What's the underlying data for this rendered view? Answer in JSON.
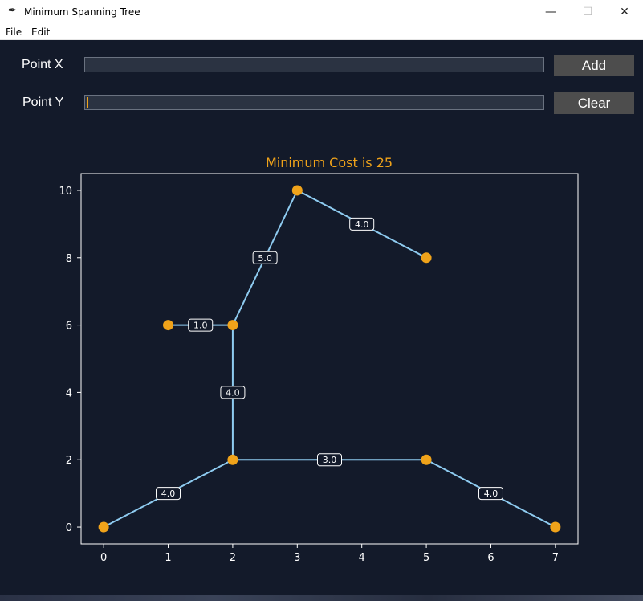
{
  "window": {
    "title": "Minimum Spanning Tree",
    "icon": "feather-icon"
  },
  "menu": {
    "file": "File",
    "edit": "Edit"
  },
  "form": {
    "point_x_label": "Point X",
    "point_x_value": "",
    "point_y_label": "Point Y",
    "point_y_value": "",
    "add_label": "Add",
    "clear_label": "Clear"
  },
  "colors": {
    "background": "#131a2a",
    "title": "#f0a31a",
    "node": "#f0a31a",
    "edge": "#8ecbf0",
    "axes": "#ffffff"
  },
  "chart_data": {
    "type": "scatter",
    "title": "Minimum Cost is 25",
    "xlabel": "",
    "ylabel": "",
    "xlim": [
      -0.35,
      7.35
    ],
    "ylim": [
      -0.5,
      10.5
    ],
    "xticks": [
      0,
      1,
      2,
      3,
      4,
      5,
      6,
      7
    ],
    "yticks": [
      0,
      2,
      4,
      6,
      8,
      10
    ],
    "grid": false,
    "nodes": [
      {
        "x": 0,
        "y": 0
      },
      {
        "x": 2,
        "y": 2
      },
      {
        "x": 5,
        "y": 2
      },
      {
        "x": 7,
        "y": 0
      },
      {
        "x": 2,
        "y": 6
      },
      {
        "x": 1,
        "y": 6
      },
      {
        "x": 3,
        "y": 10
      },
      {
        "x": 5,
        "y": 8
      }
    ],
    "edges": [
      {
        "from": [
          0,
          0
        ],
        "to": [
          2,
          2
        ],
        "weight": "4.0"
      },
      {
        "from": [
          2,
          2
        ],
        "to": [
          5,
          2
        ],
        "weight": "3.0"
      },
      {
        "from": [
          5,
          2
        ],
        "to": [
          7,
          0
        ],
        "weight": "4.0"
      },
      {
        "from": [
          2,
          2
        ],
        "to": [
          2,
          6
        ],
        "weight": "4.0"
      },
      {
        "from": [
          1,
          6
        ],
        "to": [
          2,
          6
        ],
        "weight": "1.0"
      },
      {
        "from": [
          2,
          6
        ],
        "to": [
          3,
          10
        ],
        "weight": "5.0"
      },
      {
        "from": [
          3,
          10
        ],
        "to": [
          5,
          8
        ],
        "weight": "4.0"
      }
    ]
  }
}
